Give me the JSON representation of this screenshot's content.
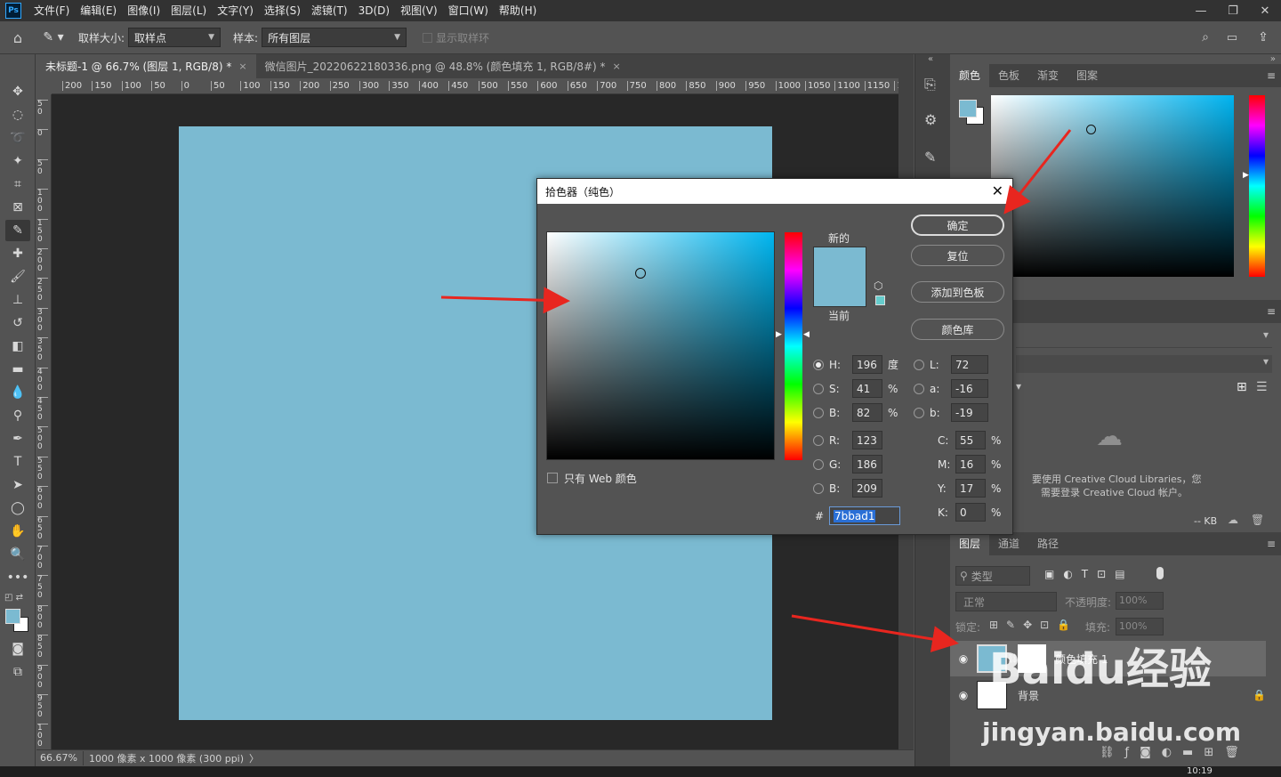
{
  "app": {
    "logo": "Ps",
    "menu": [
      "文件(F)",
      "编辑(E)",
      "图像(I)",
      "图层(L)",
      "文字(Y)",
      "选择(S)",
      "滤镜(T)",
      "3D(D)",
      "视图(V)",
      "窗口(W)",
      "帮助(H)"
    ],
    "window_controls": [
      "—",
      "❐",
      "✕"
    ]
  },
  "options_bar": {
    "sample_size_label": "取样大小:",
    "sample_size_value": "取样点",
    "sample_label": "样本:",
    "sample_value": "所有图层",
    "show_ring_label": "显示取样环"
  },
  "tabs": [
    {
      "label": "未标题-1 @ 66.7% (图层 1, RGB/8) *",
      "close": "×"
    },
    {
      "label": "微信图片_20220622180336.png @ 48.8% (颜色填充 1, RGB/8#) *",
      "close": "×"
    }
  ],
  "ruler": {
    "h_ticks": [
      "200",
      "150",
      "100",
      "50",
      "0",
      "50",
      "100",
      "150",
      "200",
      "250",
      "300",
      "350",
      "400",
      "450",
      "500",
      "550",
      "600",
      "650",
      "700",
      "750",
      "800",
      "850",
      "900",
      "950",
      "1000",
      "1050",
      "1100",
      "1150",
      "1"
    ],
    "v_ticks": [
      "5 0",
      "0",
      "5 0",
      "1 0 0",
      "1 5 0",
      "2 0 0",
      "2 5 0",
      "3 0 0",
      "3 5 0",
      "4 0 0",
      "4 5 0",
      "5 0 0",
      "5 5 0",
      "6 0 0",
      "6 5 0",
      "7 0 0",
      "7 5 0",
      "8 0 0",
      "8 5 0",
      "9 0 0",
      "9 5 0",
      "1 0 0"
    ]
  },
  "document": {
    "fill_color": "#7bbad1"
  },
  "status_bar": {
    "zoom": "66.67%",
    "info": "1000 像素 x 1000 像素 (300 ppi)",
    "arrow": "〉"
  },
  "color_panel": {
    "tabs": [
      "颜色",
      "色板",
      "渐变",
      "图案"
    ],
    "menu_icon": "≡"
  },
  "libraries_panel": {
    "message_line1": "要使用 Creative Cloud Libraries，您",
    "message_line2": "需要登录 Creative Cloud 帐户。",
    "size": "-- KB"
  },
  "layers_panel": {
    "tabs": [
      "图层",
      "通道",
      "路径"
    ],
    "filter_label": "类型",
    "blend_mode": "正常",
    "opacity_label": "不透明度:",
    "opacity_value": "100%",
    "lock_label": "锁定:",
    "fill_label": "填充:",
    "fill_value": "100%",
    "layers": [
      {
        "name": "颜色填充 1",
        "selected": true
      },
      {
        "name": "背景",
        "selected": false
      }
    ]
  },
  "color_picker": {
    "title": "拾色器（纯色）",
    "close": "✕",
    "buttons": {
      "ok": "确定",
      "reset": "复位",
      "add_swatch": "添加到色板",
      "libraries": "颜色库"
    },
    "new_label": "新的",
    "current_label": "当前",
    "web_only_label": "只有 Web 颜色",
    "hsb": [
      {
        "label": "H:",
        "value": "196",
        "unit": "度",
        "selected": true
      },
      {
        "label": "S:",
        "value": "41",
        "unit": "%",
        "selected": false
      },
      {
        "label": "B:",
        "value": "82",
        "unit": "%",
        "selected": false
      }
    ],
    "rgb": [
      {
        "label": "R:",
        "value": "123"
      },
      {
        "label": "G:",
        "value": "186"
      },
      {
        "label": "B:",
        "value": "209"
      }
    ],
    "lab": [
      {
        "label": "L:",
        "value": "72"
      },
      {
        "label": "a:",
        "value": "-16"
      },
      {
        "label": "b:",
        "value": "-19"
      }
    ],
    "cmyk": [
      {
        "label": "C:",
        "value": "55",
        "unit": "%"
      },
      {
        "label": "M:",
        "value": "16",
        "unit": "%"
      },
      {
        "label": "Y:",
        "value": "17",
        "unit": "%"
      },
      {
        "label": "K:",
        "value": "0",
        "unit": "%"
      }
    ],
    "hex_label": "#",
    "hex_value": "7bbad1",
    "new_color": "#7bbad1",
    "current_color": "#7bbad1"
  },
  "watermark": {
    "brand": "Baidu经验",
    "url": "jingyan.baidu.com"
  },
  "clock": "10:19",
  "colors": {
    "accent": "#31a8ff",
    "arrow": "#e8261f"
  }
}
